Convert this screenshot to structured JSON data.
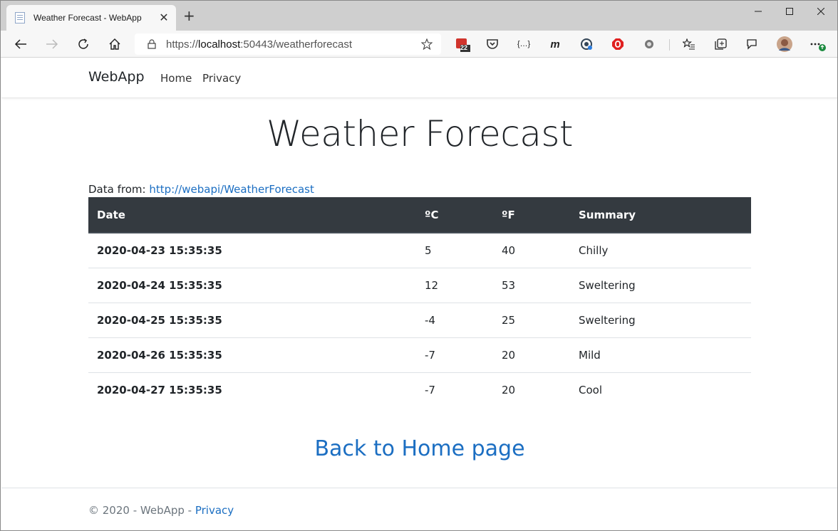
{
  "browser": {
    "tab_title": "Weather Forecast - WebApp",
    "url_scheme": "https://",
    "url_host": "localhost",
    "url_rest": ":50443/weatherforecast",
    "extensions": {
      "calendar_badge": "22",
      "json_label": "{…}",
      "m_label": "m"
    }
  },
  "navbar": {
    "brand": "WebApp",
    "links": [
      "Home",
      "Privacy"
    ]
  },
  "main": {
    "title": "Weather Forecast",
    "source_label": "Data from: ",
    "source_link": "http://webapi/WeatherForecast",
    "table": {
      "headers": [
        "Date",
        "ºC",
        "ºF",
        "Summary"
      ],
      "rows": [
        [
          "2020-04-23 15:35:35",
          "5",
          "40",
          "Chilly"
        ],
        [
          "2020-04-24 15:35:35",
          "12",
          "53",
          "Sweltering"
        ],
        [
          "2020-04-25 15:35:35",
          "-4",
          "25",
          "Sweltering"
        ],
        [
          "2020-04-26 15:35:35",
          "-7",
          "20",
          "Mild"
        ],
        [
          "2020-04-27 15:35:35",
          "-7",
          "20",
          "Cool"
        ]
      ]
    },
    "back_link": "Back to Home page"
  },
  "footer": {
    "copyright": "© 2020 - WebApp - ",
    "privacy_link": "Privacy"
  },
  "colors": {
    "link": "#1b6ec2",
    "table_header_bg": "#343a40",
    "tab_strip": "#cfcfcf"
  }
}
